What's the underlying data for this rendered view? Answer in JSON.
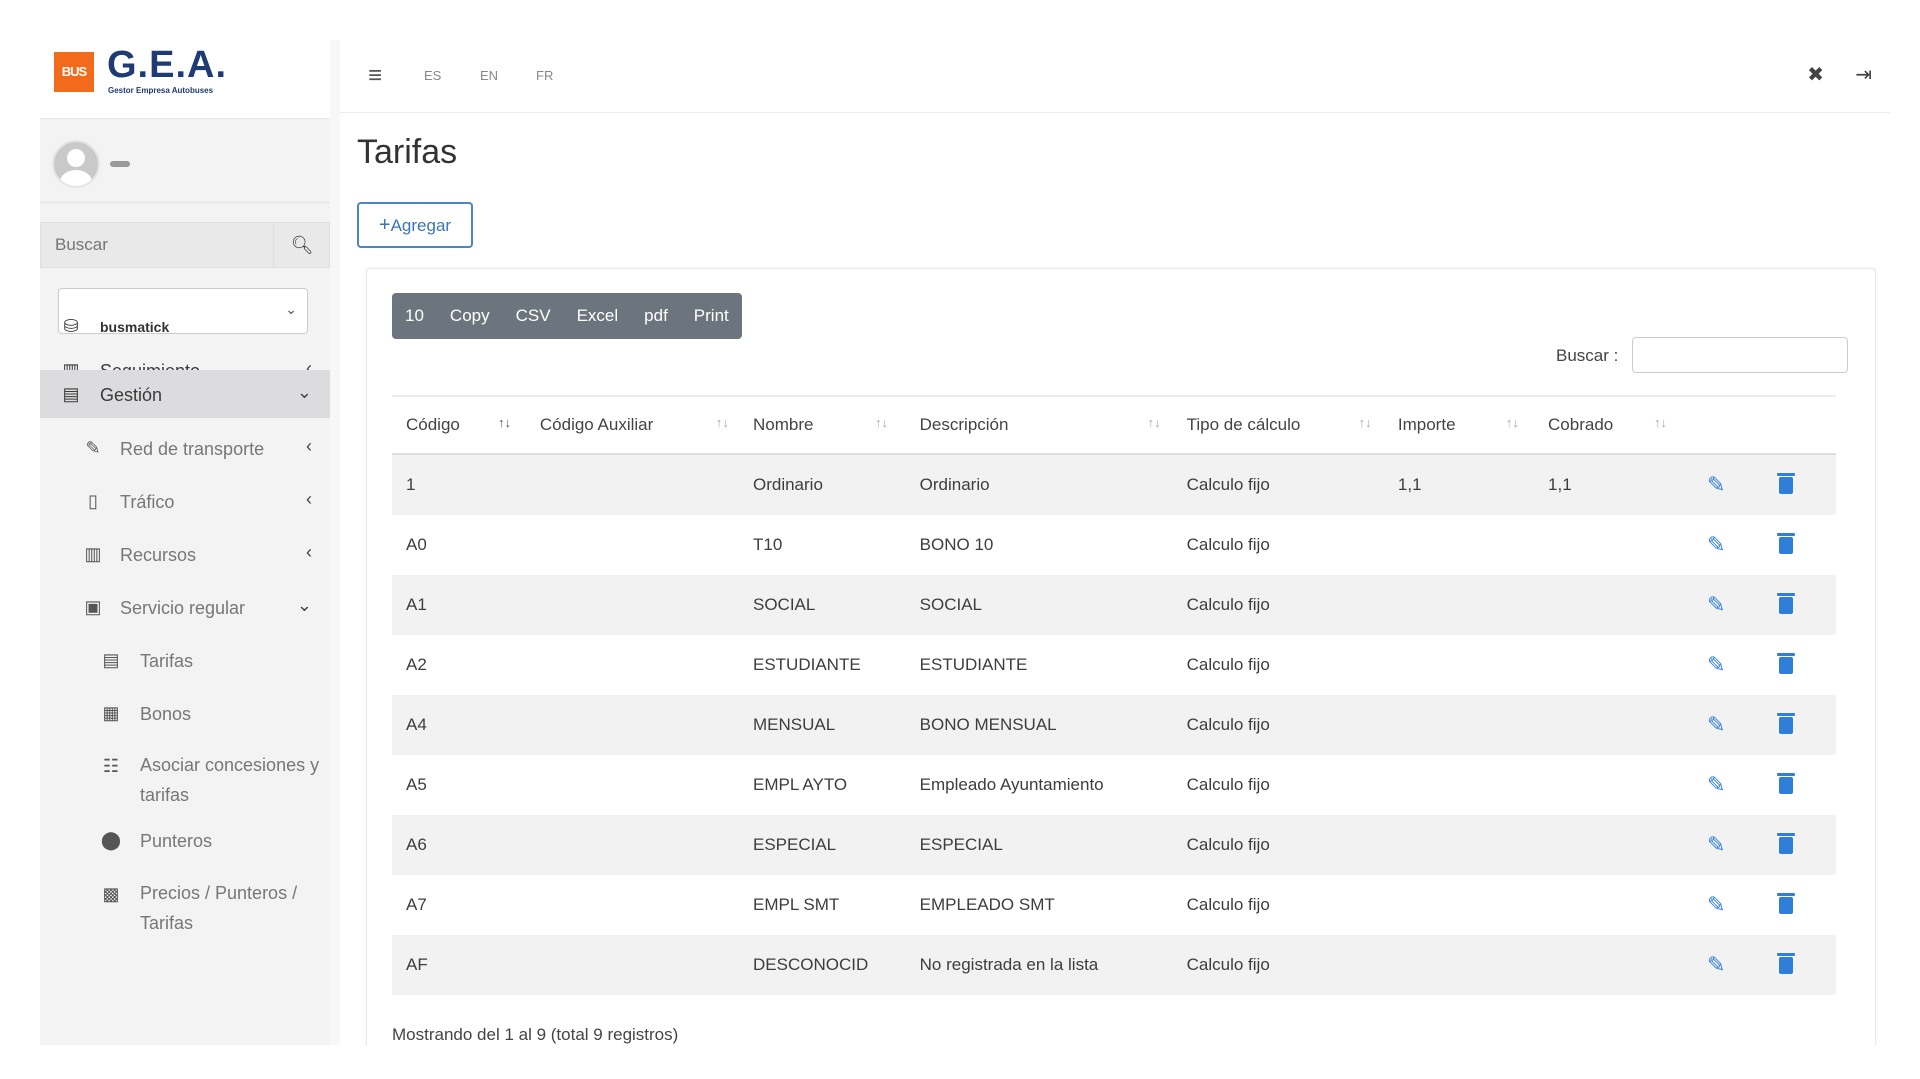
{
  "brand": {
    "logo_text": "BUS",
    "name": "G.E.A.",
    "subtitle": "Gestor Empresa Autobuses"
  },
  "sidebar": {
    "search_placeholder": "Buscar",
    "company": "busmatick",
    "items": [
      {
        "label": "Seguimiento",
        "icon": "map-icon"
      },
      {
        "label": "Gestión",
        "icon": "book-icon"
      },
      {
        "label": "Red de transporte",
        "icon": "pencil-icon"
      },
      {
        "label": "Tráfico",
        "icon": "traffic-icon"
      },
      {
        "label": "Recursos",
        "icon": "books-icon"
      },
      {
        "label": "Servicio regular",
        "icon": "bus-icon"
      },
      {
        "label": "Tarifas",
        "icon": "ticket-icon"
      },
      {
        "label": "Bonos",
        "icon": "card-icon"
      },
      {
        "label": "Asociar concesiones y tarifas",
        "icon": "sitemap-icon"
      },
      {
        "label": "Punteros",
        "icon": "map-pin-icon"
      },
      {
        "label": "Precios / Punteros / Tarifas",
        "icon": "price-icon"
      }
    ]
  },
  "topbar": {
    "languages": [
      "ES",
      "EN",
      "FR"
    ]
  },
  "page": {
    "title": "Tarifas",
    "add_label": "Agregar"
  },
  "table_tools": {
    "buttons": [
      "10",
      "Copy",
      "CSV",
      "Excel",
      "pdf",
      "Print"
    ],
    "search_label": "Buscar :"
  },
  "table": {
    "columns": [
      "Código",
      "Código Auxiliar",
      "Nombre",
      "Descripción",
      "Tipo de cálculo",
      "Importe",
      "Cobrado"
    ],
    "rows": [
      [
        "1",
        "",
        "Ordinario",
        "Ordinario",
        "Calculo fijo",
        "1,1",
        "1,1"
      ],
      [
        "A0",
        "",
        "T10",
        "BONO 10",
        "Calculo fijo",
        "",
        ""
      ],
      [
        "A1",
        "",
        "SOCIAL",
        "SOCIAL",
        "Calculo fijo",
        "",
        ""
      ],
      [
        "A2",
        "",
        "ESTUDIANTE",
        "ESTUDIANTE",
        "Calculo fijo",
        "",
        ""
      ],
      [
        "A4",
        "",
        "MENSUAL",
        "BONO MENSUAL",
        "Calculo fijo",
        "",
        ""
      ],
      [
        "A5",
        "",
        "EMPL AYTO",
        "Empleado Ayuntamiento",
        "Calculo fijo",
        "",
        ""
      ],
      [
        "A6",
        "",
        "ESPECIAL",
        "ESPECIAL",
        "Calculo fijo",
        "",
        ""
      ],
      [
        "A7",
        "",
        "EMPL SMT",
        "EMPLEADO SMT",
        "Calculo fijo",
        "",
        ""
      ],
      [
        "AF",
        "",
        "DESCONOCID",
        "No registrada en la lista",
        "Calculo fijo",
        "",
        ""
      ]
    ],
    "info": "Mostrando del 1 al 9 (total 9 registros)"
  },
  "colors": {
    "accent": "#2f7ed8",
    "brand_orange": "#f26b1d",
    "brand_blue": "#1f3b73",
    "button_gray": "#6c757d"
  }
}
